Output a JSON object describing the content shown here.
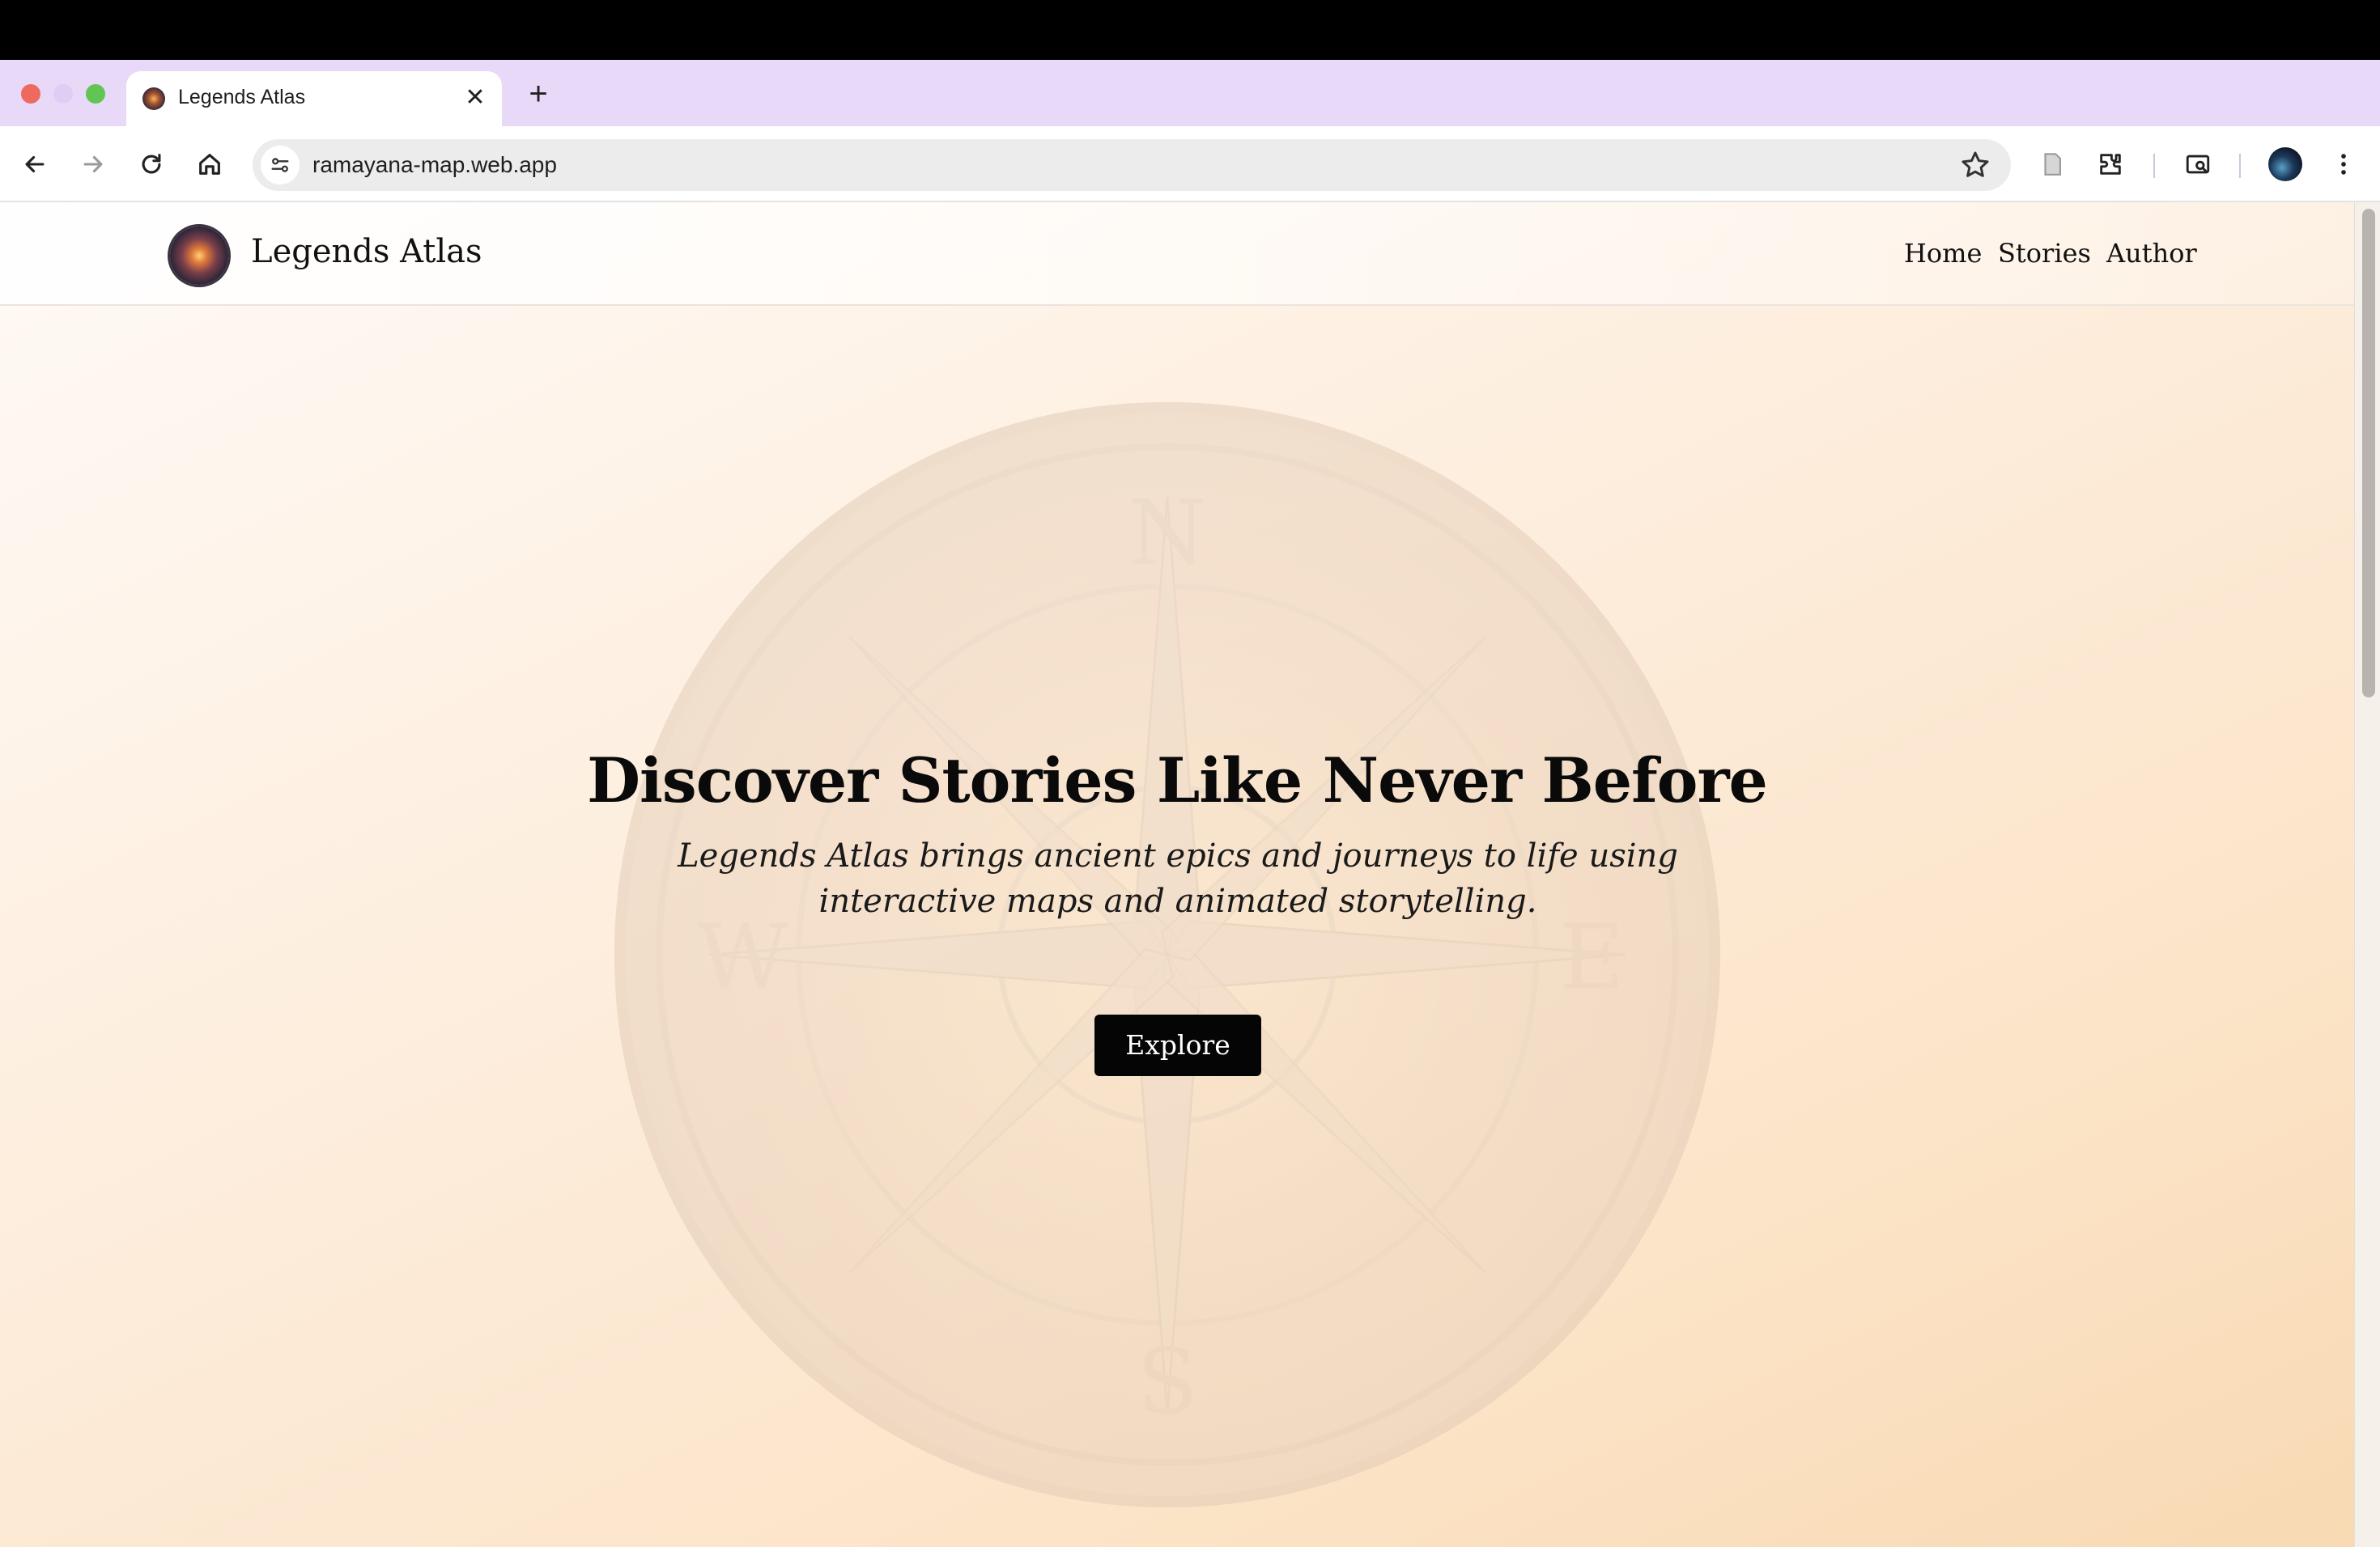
{
  "browser": {
    "tab": {
      "title": "Legends Atlas",
      "close_glyph": "✕"
    },
    "new_tab_glyph": "+",
    "url": "ramayana-map.web.app",
    "icons": [
      "back-icon",
      "forward-icon",
      "reload-icon",
      "home-icon",
      "site-settings-icon",
      "bookmark-star-icon",
      "document-icon",
      "extensions-icon",
      "tab-search-icon",
      "profile-avatar",
      "more-menu-icon"
    ]
  },
  "site": {
    "brand": "Legends Atlas",
    "nav": [
      {
        "label": "Home"
      },
      {
        "label": "Stories"
      },
      {
        "label": "Author"
      }
    ],
    "hero": {
      "title": "Discover Stories Like Never Before",
      "subtitle": "Legends Atlas brings ancient epics and journeys to life using interactive maps and animated storytelling.",
      "cta_label": "Explore"
    },
    "compass_letters": {
      "n": "N",
      "s": "S",
      "e": "E",
      "w": "W"
    }
  },
  "colors": {
    "tabstrip": "#e8d9f8",
    "page_gradient_start": "#fffaf6",
    "page_gradient_end": "#f8d9b2",
    "cta_bg": "#050505",
    "cta_text": "#ffffff"
  }
}
